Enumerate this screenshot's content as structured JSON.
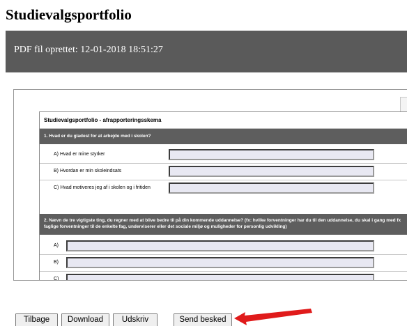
{
  "page": {
    "title": "Studievalgsportfolio",
    "created_label": "PDF fil oprettet: 12-01-2018 18:51:27"
  },
  "form": {
    "title": "Studievalgsportfolio - afrapporteringsskema",
    "q1": {
      "text": "1. Hvad er du gladest for at arbejde med i skolen?",
      "rows": [
        {
          "label": "A) Hvad er mine styrker",
          "value": ""
        },
        {
          "label": "B) Hvordan er min skoleindsats",
          "value": ""
        },
        {
          "label": "C) Hvad motiveres jeg af i skolen og i fritiden",
          "value": ""
        }
      ]
    },
    "q2": {
      "text": "2. Nævn de tre vigtigste ting, du regner med at blive bedre til på din kommende uddannelse?",
      "hint": "(fx: hvilke forventninger har du til den uddannelse, du skal i gang med fx faglige forventninger til de enkelte fag, underviserer eller det sociale miljø og muligheder for personlig udvikling)",
      "rows": [
        {
          "label": "A)",
          "value": ""
        },
        {
          "label": "B)",
          "value": ""
        },
        {
          "label": "C)",
          "value": ""
        }
      ]
    }
  },
  "buttons": {
    "back": "Tilbage",
    "download": "Download",
    "print": "Udskriv",
    "send": "Send besked"
  },
  "colors": {
    "header_band": "#5a5a5a",
    "question_band": "#5e5e5e",
    "field_fill": "#e8e8f2",
    "arrow": "#e01b1b"
  }
}
